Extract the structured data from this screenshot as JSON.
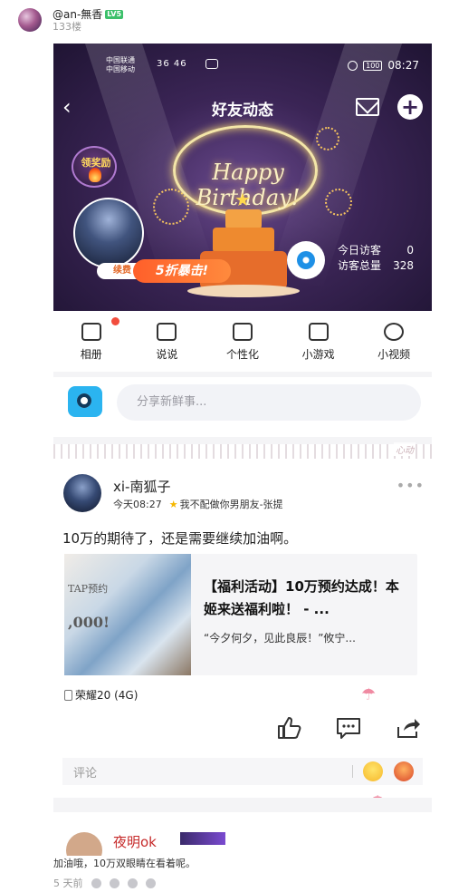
{
  "comment": {
    "username": "@an-無香",
    "level": "LV5",
    "floor": "133楼",
    "reply_text": "加油哦，10万双眼睛在看着呢。",
    "reply_time": "5 天前"
  },
  "phone": {
    "status": {
      "carrier1": "中国联通",
      "carrier2": "中国移动",
      "signal": "36 46",
      "battery": "100",
      "time": "08:27"
    },
    "nav": {
      "title": "好友动态",
      "back": "‹",
      "plus": "+"
    },
    "banner": {
      "reward": "领奖励",
      "neon": "Happy Birthday!",
      "vip": "续费",
      "sale": "5折暴击!",
      "today_label": "今日访客",
      "today_value": "0",
      "total_label": "访客总量",
      "total_value": "328"
    },
    "tools": [
      {
        "label": "相册",
        "icon": "album-icon"
      },
      {
        "label": "说说",
        "icon": "chat-icon"
      },
      {
        "label": "个性化",
        "icon": "shirt-icon"
      },
      {
        "label": "小游戏",
        "icon": "gamepad-icon"
      },
      {
        "label": "小视频",
        "icon": "video-icon"
      }
    ],
    "share": {
      "placeholder": "分享新鲜事..."
    },
    "deco_text": "心动",
    "feed": {
      "name": "xi-南狐子",
      "time": "今天08:27",
      "relation": "我不配做你男朋友-张提",
      "more": "•••",
      "text": "10万的期待了，还是需要继续加油啊。",
      "card": {
        "title": "【福利活动】10万预约达成！本姬来送福利啦！ - ...",
        "desc": "“今夕何夕，见此良辰！”攸宁...",
        "img_text1": "TAP预约",
        "img_text2": ",000!"
      },
      "device": "荣耀20 (4G)",
      "comment_placeholder": "评论"
    },
    "next_name": "夜明ok"
  },
  "colors": {
    "accent_blue": "#2bb4f0",
    "badge_red": "#f24d3d",
    "level_green": "#3cc06a"
  }
}
